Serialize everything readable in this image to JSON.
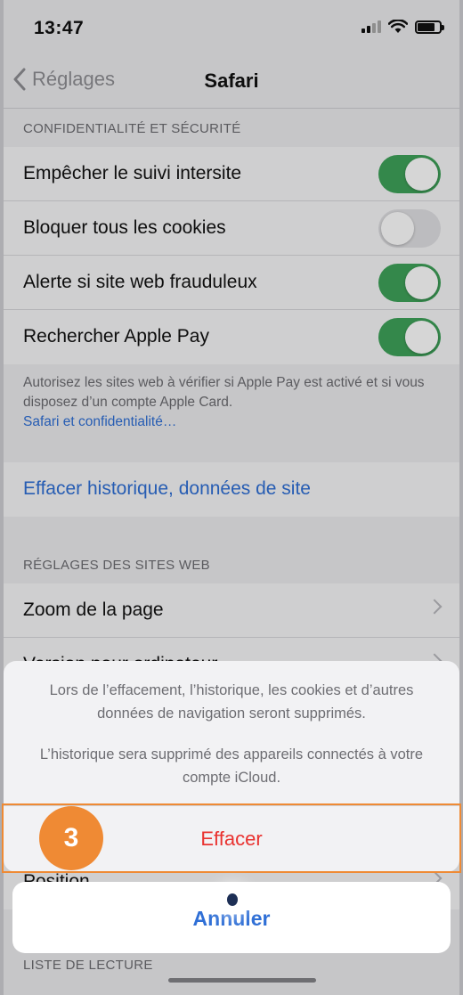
{
  "status_bar": {
    "time": "13:47"
  },
  "nav": {
    "back_label": "Réglages",
    "title": "Safari"
  },
  "privacy": {
    "header": "CONFIDENTIALITÉ ET SÉCURITÉ",
    "rows": [
      {
        "label": "Empêcher le suivi intersite",
        "on": true
      },
      {
        "label": "Bloquer tous les cookies",
        "on": false
      },
      {
        "label": "Alerte si site web frauduleux",
        "on": true
      },
      {
        "label": "Rechercher Apple Pay",
        "on": true
      }
    ],
    "footnote": "Autorisez les sites web à vérifier si Apple Pay est activé et si vous disposez d’un compte Apple Card.",
    "footnote_link": "Safari et confidentialité…"
  },
  "clear_history": {
    "label": "Effacer historique, données de site"
  },
  "website_settings": {
    "header": "RÉGLAGES DES SITES WEB",
    "rows": [
      {
        "label": "Zoom de la page"
      },
      {
        "label": "Version pour ordinateur"
      },
      {
        "label": "Position"
      }
    ]
  },
  "reading_list": {
    "header": "LISTE DE LECTURE"
  },
  "action_sheet": {
    "message_1": "Lors de l’effacement, l’historique, les cookies et d’autres données de navigation seront supprimés.",
    "message_2": "L’historique sera supprimé des appareils connectés à votre compte iCloud.",
    "confirm_label": "Effacer",
    "cancel_label": "Annuler"
  },
  "annotation": {
    "step_number": "3"
  },
  "colors": {
    "accent": "#2f6fd6",
    "destructive": "#e9322f",
    "toggle_on": "#3fa35a",
    "highlight": "#ef8a34"
  }
}
